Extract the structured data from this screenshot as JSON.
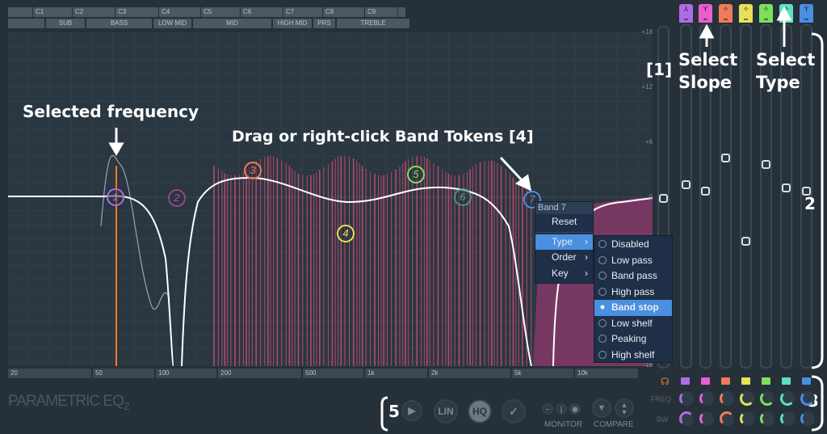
{
  "octaves": [
    "",
    "C1",
    "C2",
    "C3",
    "C4",
    "C5",
    "C6",
    "C7",
    "C8",
    "C9",
    ""
  ],
  "ranges": [
    "",
    "SUB",
    "BASS",
    "LOW MID",
    "MID",
    "HIGH MID",
    "PRS",
    "TREBLE"
  ],
  "gain_labels": {
    "p18": "+18",
    "p12": "+12",
    "p6": "+6",
    "zero": "0",
    "m18": "-18"
  },
  "freq_labels": [
    "20",
    "50",
    "100",
    "200",
    "500",
    "1k",
    "2k",
    "5k",
    "10k"
  ],
  "band_colors": [
    "#b06be8",
    "#e95fd0",
    "#f07a5a",
    "#e8e05a",
    "#7ee05a",
    "#5ee0c0",
    "#4a8fe0"
  ],
  "bands": [
    {
      "n": "1",
      "gain_pct": 48
    },
    {
      "n": "2",
      "gain_pct": 50
    },
    {
      "n": "3",
      "gain_pct": 40
    },
    {
      "n": "4",
      "gain_pct": 65
    },
    {
      "n": "5",
      "gain_pct": 42
    },
    {
      "n": "6",
      "gain_pct": 49
    },
    {
      "n": "7",
      "gain_pct": 50
    }
  ],
  "annotations": {
    "selected_frequency": "Selected frequency",
    "drag_tokens": "Drag or right-click Band Tokens [4]",
    "one": "[1]",
    "select_slope": "Select Slope",
    "select_type": "Select Type",
    "two": "2",
    "three": "3",
    "five": "5"
  },
  "context_menu": {
    "title": "Band 7",
    "items": [
      {
        "label": "Reset"
      },
      {
        "label": "Type"
      },
      {
        "label": "Order"
      },
      {
        "label": "Key"
      }
    ],
    "type_options": [
      "Disabled",
      "Low pass",
      "Band pass",
      "High pass",
      "Band stop",
      "Low shelf",
      "Peaking",
      "High shelf"
    ],
    "selected_type": "Band stop"
  },
  "bottom": {
    "logo": "PARAMETRIC EQ",
    "logo_sub": "2",
    "lin": "LIN",
    "hq": "HQ",
    "monitor": "MONITOR",
    "compare": "COMPARE",
    "freq": "FREQ",
    "bw": "BW"
  },
  "colors": {
    "accent": "#4a8fe0",
    "spectrum": "#e0507a",
    "selected": "#ff7a20"
  }
}
